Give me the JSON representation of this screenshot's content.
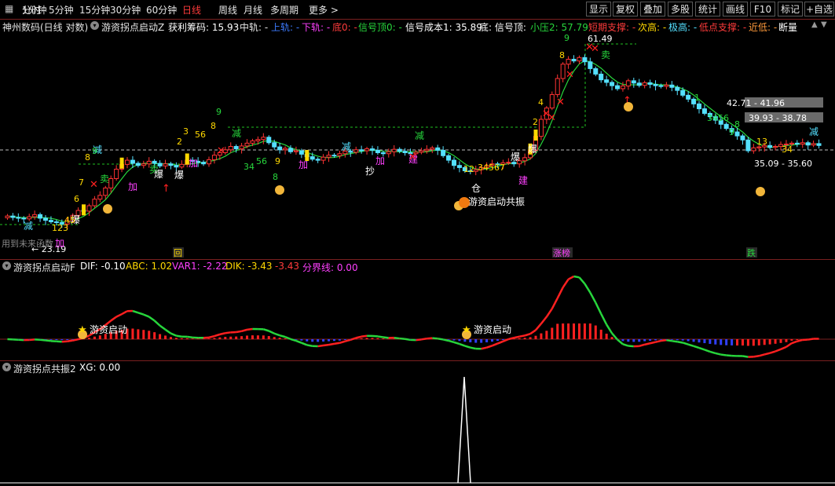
{
  "toolbar": {
    "periods": [
      "分时",
      "1分钟",
      "5分钟",
      "15分钟",
      "30分钟",
      "60分钟",
      "日线",
      "周线",
      "月线",
      "多周期",
      "更多"
    ],
    "active_period": "日线",
    "right_buttons": [
      "显示",
      "复权",
      "叠加",
      "多股",
      "统计",
      "画线",
      "F10",
      "标记",
      "+自选"
    ]
  },
  "main_panel": {
    "title": "神州数码(日线 对数)",
    "indicator_name": "游资拐点启动Z",
    "fields": {
      "profit_chip": "获利筹码: 15.93",
      "mid": "中轨: -",
      "upper": "上轨: -",
      "lower": "下轨: -",
      "bottom0": "底0: -",
      "signal_top0": "信号顶0: -",
      "signal_cost": "信号成本1: 35.89",
      "bottom": "底: 信号顶:",
      "small_pressure": "小压2: 57.79",
      "short_support": "短期支撑: -",
      "second_high": "次高: -",
      "extreme_high": "极高: -",
      "low_support": "低点支撑: -",
      "near_low": "近低: -",
      "break_status": "断量"
    },
    "price_labels": [
      "42.71 - 41.96",
      "39.93 - 38.78",
      "35.09 - 35.60",
      "23.19",
      "61.49"
    ],
    "chart_texts": [
      "减",
      "卖",
      "加",
      "买",
      "爆",
      "持",
      "抄",
      "建",
      "仓",
      "游资启动共振",
      "9",
      "8",
      "7",
      "6",
      "5",
      "4",
      "3",
      "2",
      "1"
    ],
    "bottom_left_note": "用到未来函数",
    "tags": [
      "回",
      "涨榜",
      "跌"
    ]
  },
  "macd_panel": {
    "name": "游资拐点启动F",
    "dif": "DIF: -0.10",
    "abc": "ABC: 1.02",
    "var1": "VAR1: -2.22",
    "dik": "DIK: -3.43",
    "dik2": "-3.43",
    "divider": "分界线: 0.00",
    "marker_label": "游资启动"
  },
  "resonance_panel": {
    "name": "游资拐点共振2",
    "xg": "XG: 0.00"
  },
  "colors": {
    "up": "#ff3333",
    "down": "#54e0ff",
    "ma": "#27d63c",
    "accent_red": "#ff2020",
    "yellow": "#ffd800",
    "magenta": "#ff40ff",
    "grid_dash": "#1fbf1f"
  },
  "chart_data": {
    "type": "candlestick",
    "note_series": "daily candles, approximate prices (log scale)",
    "x": [
      "d1",
      "d2",
      "d3",
      "d4",
      "d5",
      "d6",
      "d7",
      "d8",
      "d9",
      "d10",
      "d11",
      "d12",
      "d13",
      "d14",
      "d15",
      "d16",
      "d17",
      "d18",
      "d19",
      "d20",
      "d21",
      "d22",
      "d23",
      "d24",
      "d25",
      "d26",
      "d27",
      "d28",
      "d29",
      "d30",
      "d31",
      "d32",
      "d33",
      "d34",
      "d35",
      "d36",
      "d37",
      "d38",
      "d39",
      "d40",
      "d41",
      "d42",
      "d43",
      "d44",
      "d45",
      "d46",
      "d47",
      "d48",
      "d49",
      "d50",
      "d51",
      "d52",
      "d53",
      "d54",
      "d55",
      "d56",
      "d57",
      "d58",
      "d59",
      "d60",
      "d61",
      "d62",
      "d63",
      "d64",
      "d65",
      "d66",
      "d67",
      "d68",
      "d69",
      "d70",
      "d71",
      "d72",
      "d73",
      "d74",
      "d75",
      "d76",
      "d77",
      "d78",
      "d79",
      "d80",
      "d81",
      "d82",
      "d83",
      "d84",
      "d85",
      "d86",
      "d87",
      "d88",
      "d89",
      "d90",
      "d91",
      "d92",
      "d93",
      "d94",
      "d95",
      "d96",
      "d97",
      "d98",
      "d99",
      "d100",
      "d101",
      "d102",
      "d103",
      "d104",
      "d105",
      "d106",
      "d107",
      "d108",
      "d109",
      "d110",
      "d111",
      "d112",
      "d113",
      "d114",
      "d115",
      "d116",
      "d117",
      "d118",
      "d119",
      "d120",
      "d121",
      "d122",
      "d123",
      "d124",
      "d125",
      "d126",
      "d127",
      "d128",
      "d129",
      "d130",
      "d131",
      "d132",
      "d133",
      "d134",
      "d135",
      "d136",
      "d137",
      "d138",
      "d139",
      "d140",
      "d141",
      "d142",
      "d143",
      "d144",
      "d145",
      "d146",
      "d147",
      "d148",
      "d149",
      "d150"
    ],
    "close": [
      24.3,
      24.1,
      24.0,
      23.9,
      24.2,
      24.5,
      24.0,
      23.7,
      23.5,
      23.4,
      23.2,
      23.6,
      24.4,
      25.1,
      25.0,
      25.8,
      26.8,
      27.4,
      28.6,
      30.2,
      31.9,
      32.8,
      33.6,
      33.0,
      32.6,
      32.9,
      33.4,
      33.0,
      32.5,
      32.9,
      32.6,
      32.3,
      32.8,
      33.6,
      33.4,
      33.2,
      32.9,
      33.7,
      34.6,
      35.1,
      35.7,
      36.4,
      35.9,
      36.5,
      37.1,
      37.6,
      37.9,
      38.4,
      37.2,
      36.3,
      35.7,
      36.0,
      35.3,
      35.5,
      34.8,
      34.3,
      33.8,
      33.6,
      34.2,
      34.6,
      34.5,
      34.9,
      35.4,
      35.2,
      35.7,
      35.5,
      35.9,
      35.6,
      35.1,
      34.9,
      35.3,
      35.8,
      35.4,
      35.1,
      34.9,
      35.2,
      35.5,
      35.8,
      36.1,
      35.6,
      34.5,
      33.6,
      32.6,
      32.2,
      31.6,
      31.5,
      31.8,
      32.2,
      32.6,
      32.9,
      32.8,
      33.1,
      33.2,
      32.9,
      33.5,
      34.1,
      35.6,
      38.6,
      42.6,
      45.5,
      49.2,
      54.0,
      58.7,
      60.4,
      59.8,
      61.0,
      59.5,
      57.2,
      55.4,
      53.6,
      52.8,
      51.8,
      50.9,
      51.7,
      53.3,
      52.6,
      51.9,
      52.7,
      52.2,
      51.8,
      51.6,
      52.0,
      51.3,
      50.4,
      49.0,
      47.9,
      46.6,
      45.3,
      44.1,
      43.3,
      42.4,
      41.4,
      40.4,
      39.6,
      38.7,
      37.8,
      35.5,
      36.1,
      36.3,
      36.6,
      36.2,
      36.4,
      36.8,
      36.9,
      37.1,
      36.9,
      37.2,
      36.7,
      37.0,
      36.6
    ],
    "macd_line": "smoothed oscillator (red rising / green falling)",
    "resonance_xg": [
      0,
      0,
      0,
      0,
      0,
      1,
      0,
      0
    ],
    "y_axis": "price (log)"
  }
}
